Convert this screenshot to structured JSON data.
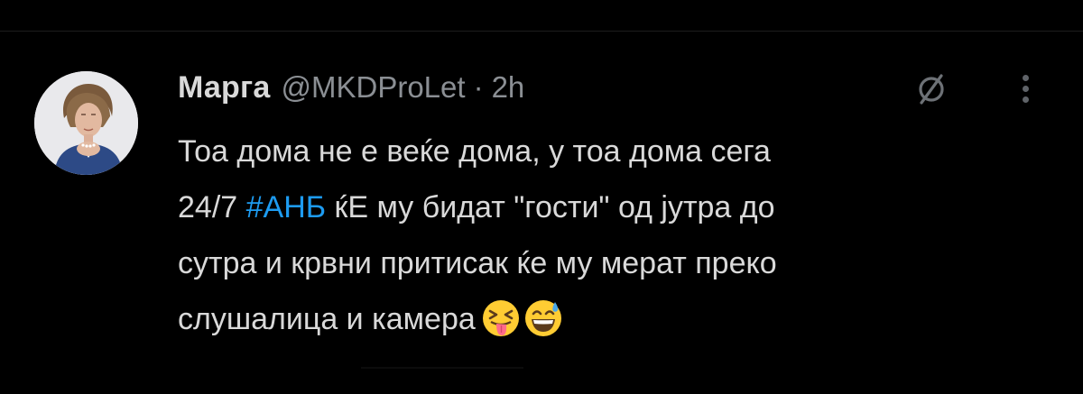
{
  "tweet": {
    "display_name": "Марга",
    "handle": "@MKDProLet",
    "separator": "·",
    "time": "2h",
    "text_lines": [
      "Тоа дома не е веќе дома, у тоа дома сега",
      "24/7",
      "#АНБ",
      "ќЕ му бидат \"гости\" од јутра до",
      "сутра и крвни притисак ќе му мерат преко",
      "слушалица и камера"
    ],
    "emojis": [
      "squinting-face-with-tongue-emoji",
      "grinning-face-with-sweat-emoji"
    ]
  },
  "icons": {
    "action": "mute-slash-icon",
    "more": "more-vertical-icon"
  },
  "colors": {
    "background": "#000000",
    "text": "#d9d9d9",
    "secondary_text": "#8b8f94",
    "hashtag": "#1d9bf0"
  }
}
